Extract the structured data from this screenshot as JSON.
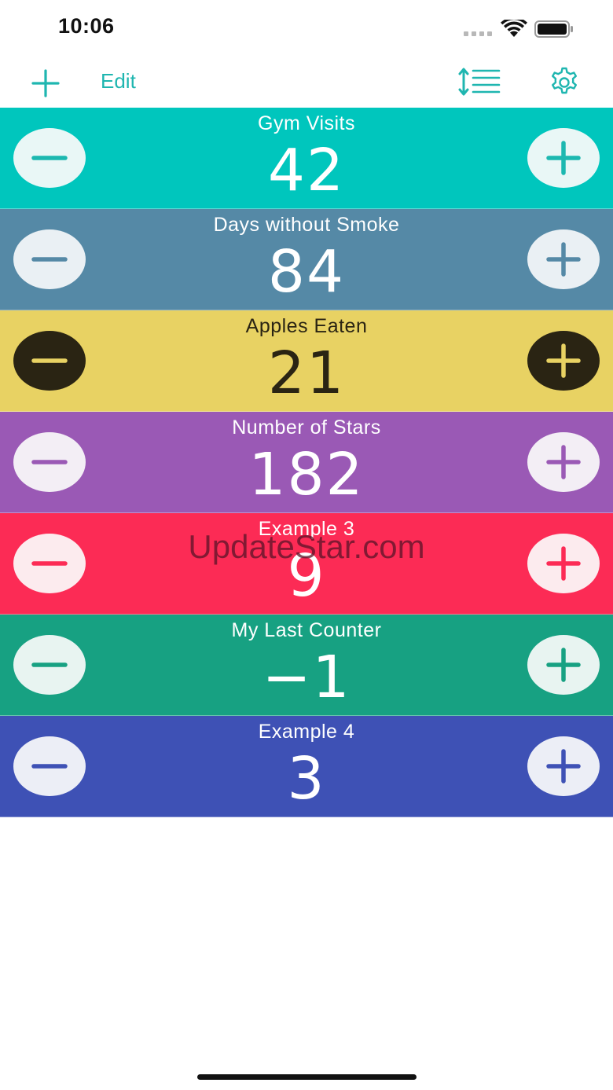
{
  "status_bar": {
    "time": "10:06"
  },
  "nav": {
    "add_icon": "plus-icon",
    "edit_label": "Edit",
    "sort_icon": "sort-lines-icon",
    "settings_icon": "gear-icon",
    "accent_color": "#1fb6b0"
  },
  "counters": [
    {
      "title": "Gym Visits",
      "value": "42",
      "bg": "#00c6bd",
      "text": "#ffffff",
      "btn_bg": "#e9f7f6",
      "btn_fg": "#1cb8b0"
    },
    {
      "title": "Days without Smoke",
      "value": "84",
      "bg": "#5589a6",
      "text": "#ffffff",
      "btn_bg": "#eaf0f4",
      "btn_fg": "#5589a6"
    },
    {
      "title": "Apples Eaten",
      "value": "21",
      "bg": "#e8d263",
      "text": "#2a2413",
      "btn_bg": "#2a2413",
      "btn_fg": "#e8d263"
    },
    {
      "title": "Number of Stars",
      "value": "182",
      "bg": "#9a59b5",
      "text": "#ffffff",
      "btn_bg": "#f3eef5",
      "btn_fg": "#9a59b5"
    },
    {
      "title": "Example 3",
      "value": "9",
      "bg": "#fc2b55",
      "text": "#ffffff",
      "btn_bg": "#fcebee",
      "btn_fg": "#fc2b55"
    },
    {
      "title": "My Last Counter",
      "value": "−1",
      "bg": "#17a182",
      "text": "#ffffff",
      "btn_bg": "#e8f4f1",
      "btn_fg": "#17a182"
    },
    {
      "title": "Example 4",
      "value": "3",
      "bg": "#3e51b5",
      "text": "#ffffff",
      "btn_bg": "#eceef6",
      "btn_fg": "#3e51b5"
    }
  ],
  "watermark": "UpdateStar.com"
}
